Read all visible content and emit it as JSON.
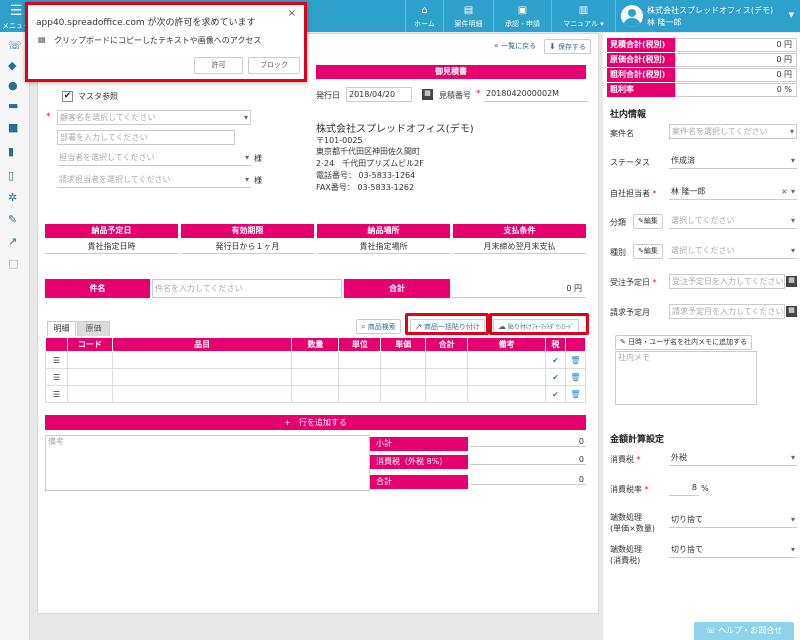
{
  "topbar": {
    "menu_label": "メニュー",
    "nav": [
      {
        "label": "ホーム",
        "icon": "home-icon",
        "glyph": "⌂"
      },
      {
        "label": "案件明細",
        "icon": "list-icon",
        "glyph": "▤"
      },
      {
        "label": "承認・申請",
        "icon": "approve-icon",
        "glyph": "▣"
      },
      {
        "label": "マニュアル",
        "icon": "manual-icon",
        "glyph": "▥"
      }
    ],
    "manual_caret": "▾",
    "user_company": "株式会社スプレッドオフィス(デモ)",
    "user_name": "林 隆一郎"
  },
  "popup": {
    "title": "app40.spreadoffice.com が次の許可を求めています",
    "message": "クリップボードにコピーしたテキストや画像へのアクセス",
    "allow": "許可",
    "block": "ブロック",
    "close": "×"
  },
  "toolbar": {
    "back": "一覧に戻る",
    "save": "保存する"
  },
  "left_form": {
    "master_ref_label": "マスタ参照",
    "customer_placeholder": "顧客名を選択してください",
    "department_placeholder": "部署を入力してください",
    "contact_placeholder": "担当者を選択してください",
    "billing_contact_placeholder": "請求担当者を選択してください",
    "honorific": "様"
  },
  "estimate": {
    "title": "御見積書",
    "issue_date_label": "発行日",
    "issue_date": "2018/04/20",
    "estimate_no_label": "見積番号",
    "estimate_no": "2018042000002M",
    "company": "株式会社スプレッドオフィス(デモ)",
    "postal": "〒101-0025",
    "address1": "東京都千代田区神田佐久間町",
    "address2": "2-24　千代田プリズムビル2F",
    "phone": "電話番号： 03-5833-1264",
    "fax": "FAX番号： 03-5833-1262"
  },
  "conditions": {
    "headers": [
      "納品予定日",
      "有効期限",
      "納品場所",
      "支払条件"
    ],
    "values": [
      "貴社指定日時",
      "発行日から１ヶ月",
      "貴社指定場所",
      "月末締め翌月末支払"
    ]
  },
  "subject": {
    "label": "件名",
    "placeholder": "件名を入力してください",
    "total_label": "合計",
    "total_value": "0 円"
  },
  "tabs": [
    "明細",
    "原価"
  ],
  "line_buttons": {
    "search": "商品検索",
    "bulk_paste": "商品一括貼り付け",
    "format_download": "貼り付けﾌｫｰﾏｯﾄﾀﾞｳﾝﾛｰﾄﾞ"
  },
  "line_table": {
    "headers": [
      "",
      "コード",
      "品目",
      "数量",
      "単位",
      "単価",
      "合計",
      "備考",
      "税",
      ""
    ],
    "add_row": "+　行を追加する",
    "row_count": 3
  },
  "notes_placeholder": "備考",
  "summary": {
    "subtotal_label": "小計",
    "subtotal": "0",
    "tax_label": "消費税（外税 8%）",
    "tax": "0",
    "total_label": "合計",
    "total": "0"
  },
  "right": {
    "totals": [
      {
        "label": "見積合計(税別)",
        "value": "0 円"
      },
      {
        "label": "原価合計(税別)",
        "value": "0 円"
      },
      {
        "label": "粗利合計(税別)",
        "value": "0 円"
      },
      {
        "label": "粗利率",
        "value": "0 %"
      }
    ],
    "info_title": "社内情報",
    "case_label": "案件名",
    "case_placeholder": "案件名を選択してください",
    "status_label": "ステータス",
    "status_value": "作成済",
    "owner_label": "自社担当者",
    "owner_value": "林 隆一郎",
    "category_label": "分類",
    "type_label": "種別",
    "edit_label": "編集",
    "select_placeholder": "選択してください",
    "order_date_label": "受注予定日",
    "order_date_placeholder": "受注予定日を入力してください",
    "billing_month_label": "請求予定月",
    "billing_month_placeholder": "請求予定月を入力してください",
    "memo_button": "日時・ユーザ名を社内メモに追加する",
    "memo_placeholder": "社内メモ",
    "calc_title": "金額計算設定",
    "tax_label": "消費税",
    "tax_value": "外税",
    "tax_rate_label": "消費税率",
    "tax_rate_value": "8",
    "tax_rate_unit": "%",
    "rounding1_label": "端数処理",
    "rounding1_sub": "(単価×数量)",
    "rounding1_value": "切り捨て",
    "rounding2_label": "端数処理",
    "rounding2_sub": "(消費税)",
    "rounding2_value": "切り捨て",
    "clear": "×"
  },
  "help_button": "ヘルプ・お問合せ",
  "colors": {
    "accent": "#2ea0cc",
    "brand_pink": "#e6006e",
    "highlight": "#e0001a"
  }
}
